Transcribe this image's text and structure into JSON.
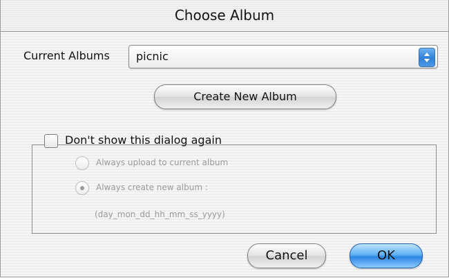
{
  "window": {
    "title": "Choose Album"
  },
  "current_albums": {
    "label": "Current Albums",
    "selected": "picnic"
  },
  "buttons": {
    "create_new_album": "Create New Album",
    "cancel": "Cancel",
    "ok": "OK"
  },
  "options": {
    "dont_show_label": "Don't show this dialog again",
    "dont_show_checked": false,
    "radio_upload_current": "Always upload to current album",
    "radio_create_new": "Always create new album :",
    "name_pattern": "(day_mon_dd_hh_mm_ss_yyyy)",
    "selected_option": "create_new",
    "enabled": false
  },
  "colors": {
    "accent": "#2e86e3",
    "disabled_text": "#9a9a9a"
  }
}
